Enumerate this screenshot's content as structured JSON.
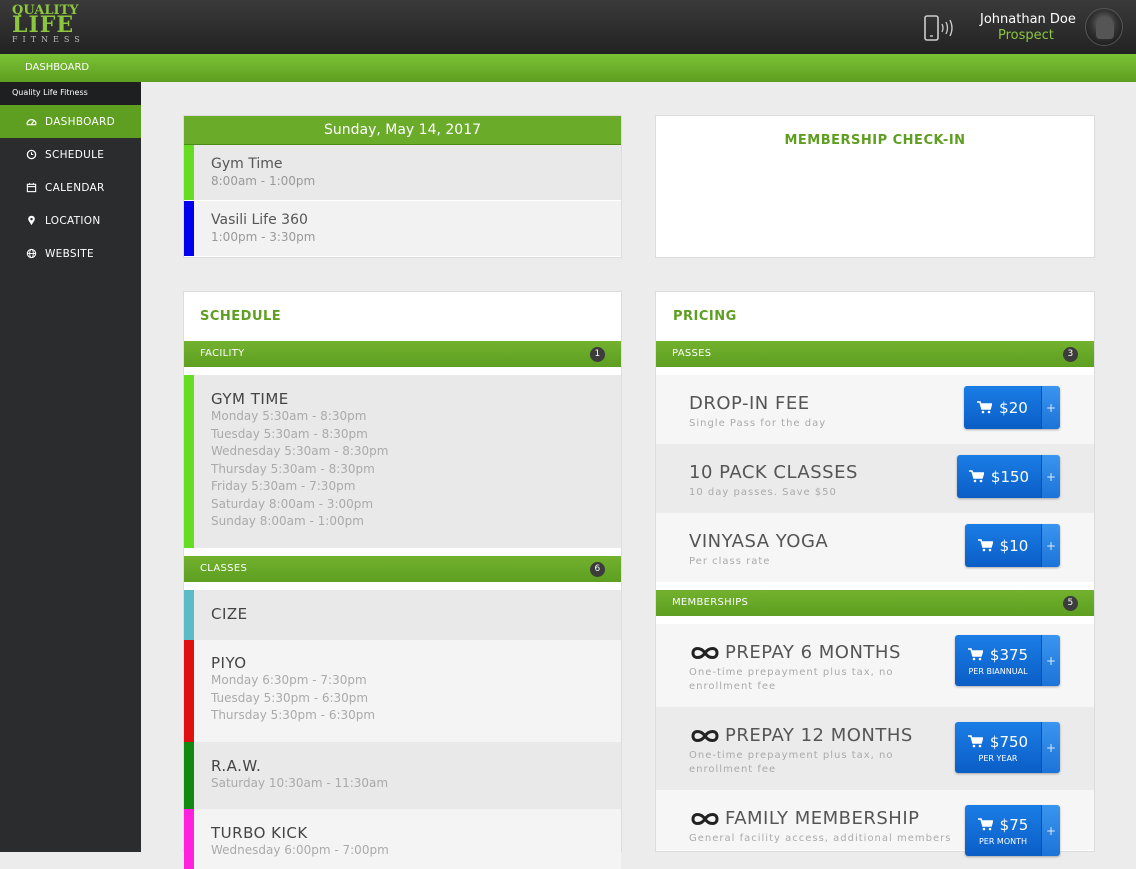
{
  "header": {
    "logo": {
      "line1": "QUALITY",
      "line2": "LIFE",
      "line3": "FITNESS"
    },
    "user_name": "Johnathan Doe",
    "user_status": "Prospect",
    "icons": [
      "phone-icon",
      "avatar"
    ]
  },
  "nav": {
    "breadcrumb": "DASHBOARD"
  },
  "sidebar": {
    "brand": "Quality Life Fitness",
    "items": [
      {
        "label": "DASHBOARD",
        "icon": "dashboard-icon",
        "active": true
      },
      {
        "label": "SCHEDULE",
        "icon": "clock-icon",
        "active": false
      },
      {
        "label": "CALENDAR",
        "icon": "calendar-icon",
        "active": false
      },
      {
        "label": "LOCATION",
        "icon": "map-pin-icon",
        "active": false
      },
      {
        "label": "WEBSITE",
        "icon": "globe-icon",
        "active": false
      }
    ]
  },
  "today": {
    "date": "Sunday, May 14, 2017",
    "events": [
      {
        "name": "Gym Time",
        "time": "8:00am - 1:00pm",
        "color": "#66dd22"
      },
      {
        "name": "Vasili Life 360",
        "time": "1:00pm - 3:30pm",
        "color": "#0000ee"
      }
    ]
  },
  "checkin": {
    "title": "MEMBERSHIP CHECK-IN"
  },
  "schedule": {
    "title": "SCHEDULE",
    "facility": {
      "header": "FACILITY",
      "count": "1",
      "item": {
        "name": "GYM TIME",
        "color": "#66dd22",
        "lines": [
          "Monday  5:30am - 8:30pm",
          "Tuesday  5:30am - 8:30pm",
          "Wednesday  5:30am - 8:30pm",
          "Thursday  5:30am - 8:30pm",
          "Friday  5:30am - 7:30pm",
          "Saturday  8:00am - 3:00pm",
          "Sunday  8:00am - 1:00pm"
        ]
      }
    },
    "classes": {
      "header": "CLASSES",
      "count": "6",
      "items": [
        {
          "name": "CIZE",
          "color": "#5bbcc8",
          "lines": []
        },
        {
          "name": "PIYO",
          "color": "#e01010",
          "lines": [
            "Monday  6:30pm - 7:30pm",
            "Tuesday  5:30pm - 6:30pm",
            "Thursday  5:30pm - 6:30pm"
          ]
        },
        {
          "name": "R.A.W.",
          "color": "#128a12",
          "lines": [
            "Saturday  10:30am - 11:30am"
          ]
        },
        {
          "name": "TURBO KICK",
          "color": "#ff22dd",
          "lines": [
            "Wednesday  6:00pm - 7:00pm"
          ]
        }
      ]
    }
  },
  "pricing": {
    "title": "PRICING",
    "passes": {
      "header": "PASSES",
      "count": "3",
      "items": [
        {
          "name": "DROP-IN FEE",
          "sub": "Single Pass for the day",
          "price": "$20",
          "per": ""
        },
        {
          "name": "10 PACK CLASSES",
          "sub": "10 day passes. Save $50",
          "price": "$150",
          "per": ""
        },
        {
          "name": "VINYASA YOGA",
          "sub": "Per class rate",
          "price": "$10",
          "per": ""
        }
      ]
    },
    "memberships": {
      "header": "MEMBERSHIPS",
      "count": "5",
      "items": [
        {
          "name": "PREPAY 6 MONTHS",
          "sub": "One-time prepayment plus tax, no enrollment fee",
          "price": "$375",
          "per": "PER BIANNUAL"
        },
        {
          "name": "PREPAY 12 MONTHS",
          "sub": "One-time prepayment plus tax, no enrollment fee",
          "price": "$750",
          "per": "PER YEAR"
        },
        {
          "name": "FAMILY MEMBERSHIP",
          "sub": "General facility access, additional members",
          "price": "$75",
          "per": "PER MONTH"
        }
      ]
    },
    "plus_label": "+"
  },
  "colors": {
    "brand_green": "#5e9e21",
    "button_blue": "#0a5ec6",
    "sidebar_bg": "#2b2c2e"
  }
}
